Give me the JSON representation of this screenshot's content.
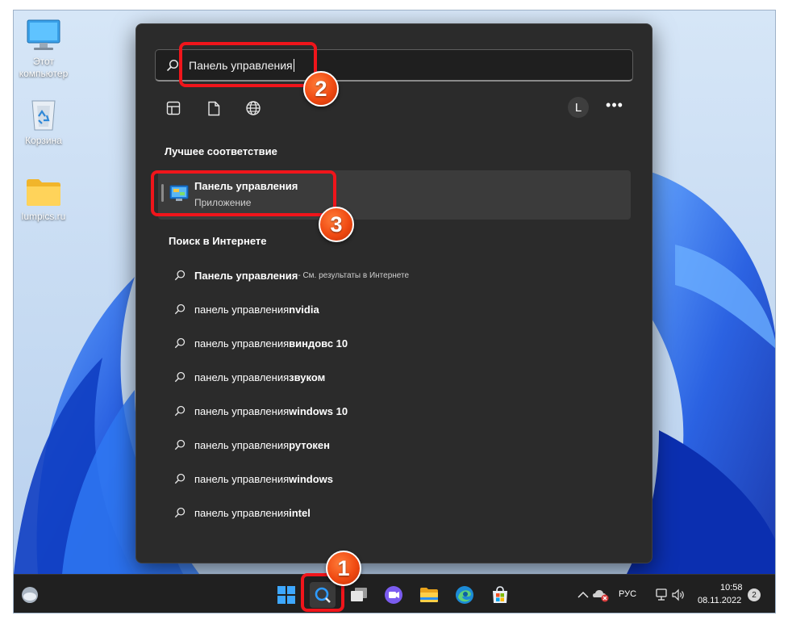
{
  "desktop": {
    "icons": [
      {
        "label": "Этот компьютер",
        "icon": "computer-icon"
      },
      {
        "label": "Корзина",
        "icon": "recycle-bin-icon"
      },
      {
        "label": "lumpics.ru",
        "icon": "folder-icon"
      }
    ]
  },
  "search": {
    "query": "Панель управления",
    "filters": [
      "apps-filter-icon",
      "documents-filter-icon",
      "web-filter-icon"
    ],
    "user_initial": "L",
    "more": "•••",
    "best_match_title": "Лучшее соответствие",
    "best_match": {
      "name": "Панель управления",
      "type": "Приложение",
      "icon": "control-panel-icon"
    },
    "web_title": "Поиск в Интернете",
    "web_results": [
      {
        "prefix": "Панель управления",
        "suffix": "",
        "hint": " - См. результаты в Интернете"
      },
      {
        "prefix": "панель управления ",
        "suffix": "nvidia",
        "hint": ""
      },
      {
        "prefix": "панель управления ",
        "suffix": "виндовс 10",
        "hint": ""
      },
      {
        "prefix": "панель управления ",
        "suffix": "звуком",
        "hint": ""
      },
      {
        "prefix": "панель управления ",
        "suffix": "windows 10",
        "hint": ""
      },
      {
        "prefix": "панель управления ",
        "suffix": "рутокен",
        "hint": ""
      },
      {
        "prefix": "панель управления ",
        "suffix": "windows",
        "hint": ""
      },
      {
        "prefix": "панель управления ",
        "suffix": "intel",
        "hint": ""
      }
    ]
  },
  "taskbar": {
    "apps": [
      "start-icon",
      "search-icon",
      "task-view-icon",
      "chat-icon",
      "file-explorer-icon",
      "edge-icon",
      "store-icon"
    ],
    "tray": {
      "language": "РУС",
      "time": "10:58",
      "date": "08.11.2022",
      "notifications": "2"
    }
  },
  "callouts": [
    "1",
    "2",
    "3"
  ],
  "colors": {
    "accent_red": "#f0151b",
    "badge_orange": "#f04a12",
    "panel_bg": "#2b2b2b",
    "taskbar_bg": "#202020"
  }
}
